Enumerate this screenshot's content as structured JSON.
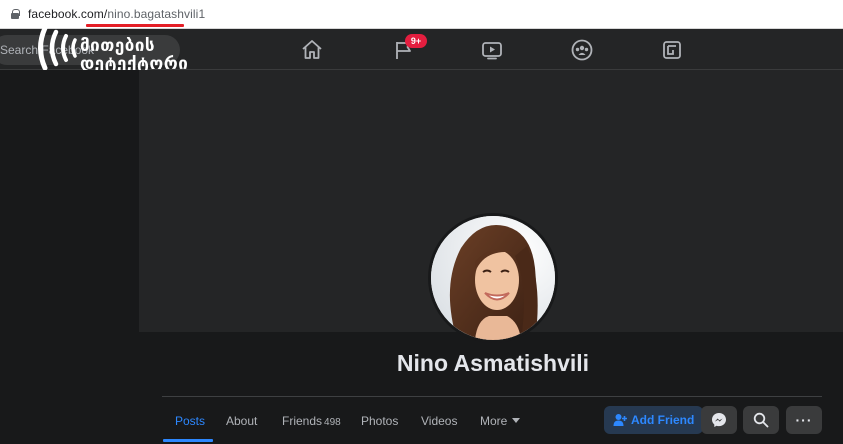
{
  "browser": {
    "url_domain": "facebook.com/",
    "url_path": "nino.bagatashvili1"
  },
  "topnav": {
    "search_placeholder": "Search Facebook",
    "pages_badge": "9+",
    "icons": [
      "home-icon",
      "pages-flag-icon",
      "watch-icon",
      "groups-icon",
      "gaming-icon"
    ]
  },
  "watermark": {
    "line1": "მითების",
    "line2": "დეტექტორი"
  },
  "profile": {
    "name": "Nino Asmatishvili"
  },
  "tabs": [
    {
      "label": "Posts",
      "active": true
    },
    {
      "label": "About"
    },
    {
      "label": "Friends",
      "count": "498"
    },
    {
      "label": "Photos"
    },
    {
      "label": "Videos"
    },
    {
      "label": "More"
    }
  ],
  "actions": {
    "add_friend": "Add Friend",
    "more_dots": "···"
  },
  "colors": {
    "accent": "#2d88ff",
    "badge": "#e41e3f",
    "url_underline": "#e41e26",
    "background": "#18191a",
    "surface": "#242526"
  }
}
